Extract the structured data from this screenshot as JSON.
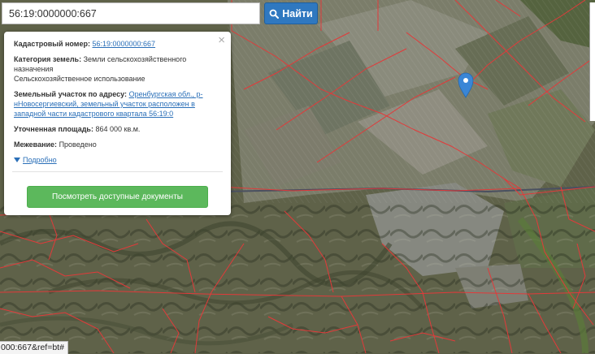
{
  "search": {
    "value": "56:19:0000000:667",
    "button_label": "Найти"
  },
  "popup": {
    "cadastral_label": "Кадастровый номер:",
    "cadastral_value": "56:19:0000000:667",
    "category_label": "Категория земель:",
    "category_value": "Земли сельскохозяйственного назначения",
    "category_use": "Сельскохозяйственное использование",
    "address_label": "Земельный участок по адресу:",
    "address_value": "Оренбургская обл., р-нНовосергиевский, земельный участок расположен в западной части кадастрового квартала 56:19:0",
    "area_label": "Уточненная площадь:",
    "area_value": "864 000 кв.м.",
    "survey_label": "Межевание:",
    "survey_value": "Проведено",
    "more_label": "Подробно",
    "docs_button": "Посмотреть доступные документы",
    "close_glyph": "×"
  },
  "status_bar": {
    "url_fragment": "000:667&ref=bt#"
  },
  "colors": {
    "boundary": "#e23a3a",
    "marker": "#3a86d6",
    "search_button": "#2f78c0",
    "docs_button": "#5cb85c",
    "link": "#2a6fb8"
  },
  "icons": {
    "search_button_icon": "search-icon",
    "marker_icon": "map-pin-icon",
    "close_icon": "close-icon",
    "expand_icon": "triangle-down-icon"
  }
}
